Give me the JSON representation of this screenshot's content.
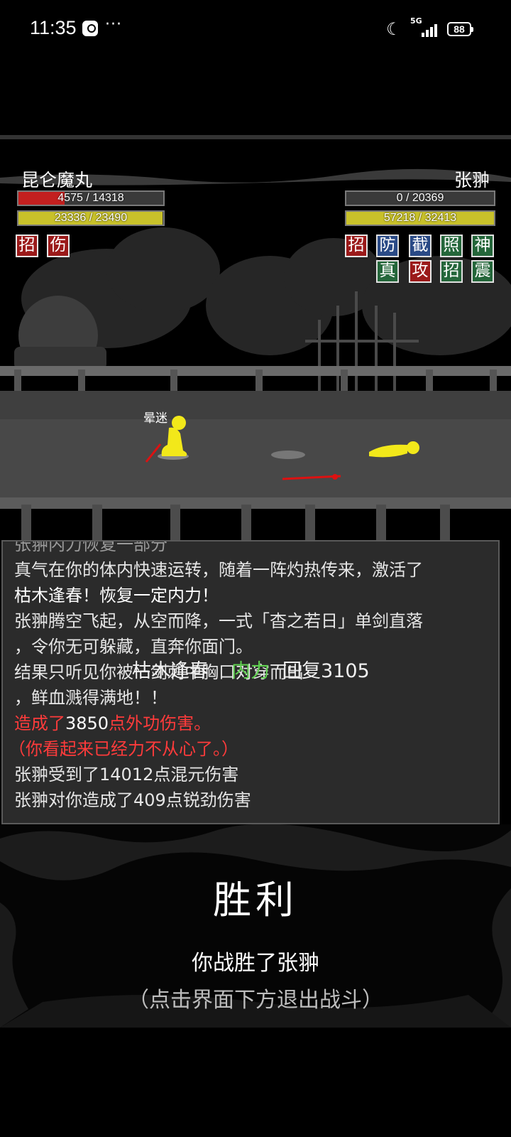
{
  "status_bar": {
    "time": "11:35",
    "dots": "···",
    "network": "5G",
    "battery": "88"
  },
  "player": {
    "name": "昆仑魔丸",
    "hp": {
      "current": 4575,
      "max": 14318,
      "text": "4575 / 14318"
    },
    "mp": {
      "current": 23336,
      "max": 23490,
      "text": "23336 / 23490"
    },
    "badges": [
      "招",
      "伤"
    ]
  },
  "enemy": {
    "name": "张翀",
    "hp": {
      "current": 0,
      "max": 20369,
      "text": "0 / 20369"
    },
    "mp": {
      "current": 57218,
      "max": 32413,
      "text": "57218 / 32413"
    },
    "badges_row1": [
      "招",
      "防",
      "截",
      "照",
      "神"
    ],
    "badges_row2": [
      "真",
      "攻",
      "招",
      "震"
    ]
  },
  "scene": {
    "status_label": "晕迷"
  },
  "log": {
    "line0": "张翀内力恢复一部分",
    "line1": "真气在你的体内快速运转，随着一阵灼热传来，激活了",
    "line2": "枯木逢春！恢复一定内力！",
    "line3": "张翀腾空飞起，从空而降，一式「杳之若日」单剑直落",
    "line4": "，令你无可躲藏，直奔你面门。",
    "line5": "结果只听见你被一剑刺中胸口对穿而出",
    "overlay_a": "枯木逢春",
    "overlay_b": "内力",
    "overlay_c": "回复3105",
    "line6": "，鲜血溅得满地！！",
    "line7a": "造成了",
    "line7b": "3850",
    "line7c": "点外功伤害。",
    "line8": "（你看起来已经力不从心了。）",
    "line9": "张翀受到了14012点混元伤害",
    "line10": "张翀对你造成了409点锐劲伤害"
  },
  "result": {
    "title": "胜利",
    "subtitle": "你战胜了张翀",
    "hint": "（点击界面下方退出战斗）"
  }
}
